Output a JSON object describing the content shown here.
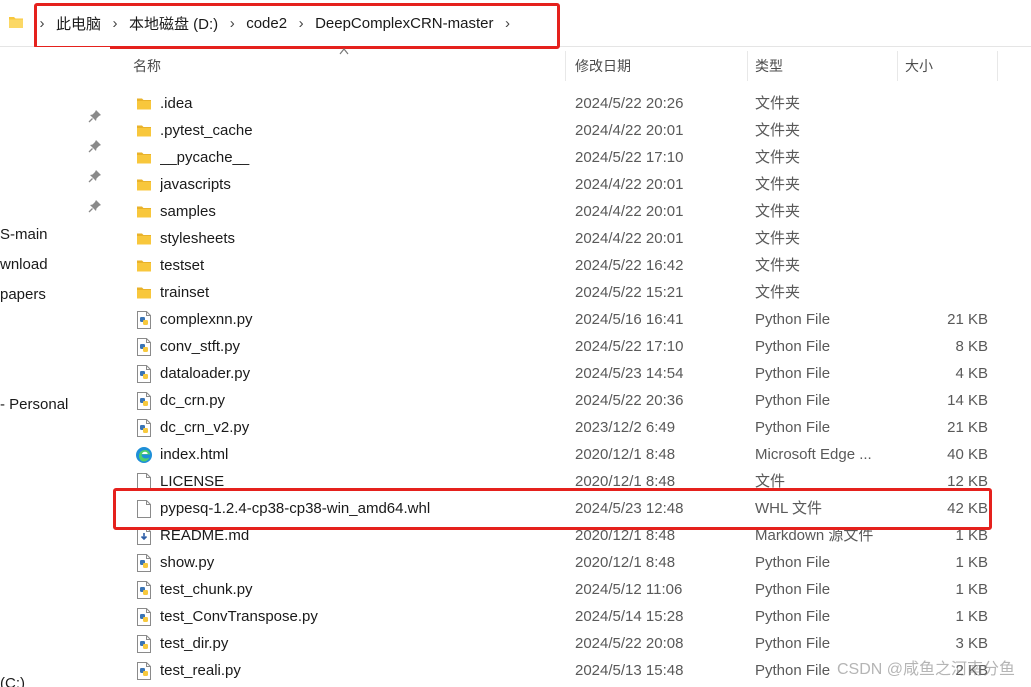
{
  "breadcrumb": {
    "items": [
      "此电脑",
      "本地磁盘 (D:)",
      "code2",
      "DeepComplexCRN-master"
    ]
  },
  "nav": {
    "items": [
      "S-main",
      "wnload",
      " papers",
      "- Personal",
      "(C:)"
    ]
  },
  "columns": {
    "name": "名称",
    "date": "修改日期",
    "type": "类型",
    "size": "大小"
  },
  "files": [
    {
      "name": ".idea",
      "date": "2024/5/22 20:26",
      "type": "文件夹",
      "size": "",
      "icon": "folder-icon"
    },
    {
      "name": ".pytest_cache",
      "date": "2024/4/22 20:01",
      "type": "文件夹",
      "size": "",
      "icon": "folder-icon"
    },
    {
      "name": "__pycache__",
      "date": "2024/5/22 17:10",
      "type": "文件夹",
      "size": "",
      "icon": "folder-icon"
    },
    {
      "name": "javascripts",
      "date": "2024/4/22 20:01",
      "type": "文件夹",
      "size": "",
      "icon": "folder-icon"
    },
    {
      "name": "samples",
      "date": "2024/4/22 20:01",
      "type": "文件夹",
      "size": "",
      "icon": "folder-icon"
    },
    {
      "name": "stylesheets",
      "date": "2024/4/22 20:01",
      "type": "文件夹",
      "size": "",
      "icon": "folder-icon"
    },
    {
      "name": "testset",
      "date": "2024/5/22 16:42",
      "type": "文件夹",
      "size": "",
      "icon": "folder-icon"
    },
    {
      "name": "trainset",
      "date": "2024/5/22 15:21",
      "type": "文件夹",
      "size": "",
      "icon": "folder-icon"
    },
    {
      "name": "complexnn.py",
      "date": "2024/5/16 16:41",
      "type": "Python File",
      "size": "21 KB",
      "icon": "python-file-icon"
    },
    {
      "name": "conv_stft.py",
      "date": "2024/5/22 17:10",
      "type": "Python File",
      "size": "8 KB",
      "icon": "python-file-icon"
    },
    {
      "name": "dataloader.py",
      "date": "2024/5/23 14:54",
      "type": "Python File",
      "size": "4 KB",
      "icon": "python-file-icon"
    },
    {
      "name": "dc_crn.py",
      "date": "2024/5/22 20:36",
      "type": "Python File",
      "size": "14 KB",
      "icon": "python-file-icon"
    },
    {
      "name": "dc_crn_v2.py",
      "date": "2023/12/2 6:49",
      "type": "Python File",
      "size": "21 KB",
      "icon": "python-file-icon"
    },
    {
      "name": "index.html",
      "date": "2020/12/1 8:48",
      "type": "Microsoft Edge ...",
      "size": "40 KB",
      "icon": "edge-html-icon"
    },
    {
      "name": "LICENSE",
      "date": "2020/12/1 8:48",
      "type": "文件",
      "size": "12 KB",
      "icon": "blank-file-icon"
    },
    {
      "name": "pypesq-1.2.4-cp38-cp38-win_amd64.whl",
      "date": "2024/5/23 12:48",
      "type": "WHL 文件",
      "size": "42 KB",
      "icon": "blank-file-icon"
    },
    {
      "name": "README.md",
      "date": "2020/12/1 8:48",
      "type": "Markdown 源文件",
      "size": "1 KB",
      "icon": "markdown-file-icon"
    },
    {
      "name": "show.py",
      "date": "2020/12/1 8:48",
      "type": "Python File",
      "size": "1 KB",
      "icon": "python-file-icon"
    },
    {
      "name": "test_chunk.py",
      "date": "2024/5/12 11:06",
      "type": "Python File",
      "size": "1 KB",
      "icon": "python-file-icon"
    },
    {
      "name": "test_ConvTranspose.py",
      "date": "2024/5/14 15:28",
      "type": "Python File",
      "size": "1 KB",
      "icon": "python-file-icon"
    },
    {
      "name": "test_dir.py",
      "date": "2024/5/22 20:08",
      "type": "Python File",
      "size": "3 KB",
      "icon": "python-file-icon"
    },
    {
      "name": "test_reali.py",
      "date": "2024/5/13 15:48",
      "type": "Python File",
      "size": "2 KB",
      "icon": "python-file-icon"
    }
  ],
  "watermark": "CSDN @咸鱼之河南分鱼",
  "colors": {
    "highlight": "#e5211d",
    "folder": "#f8c73c",
    "python_blue": "#3a74b5",
    "python_yellow": "#f7c93e"
  }
}
